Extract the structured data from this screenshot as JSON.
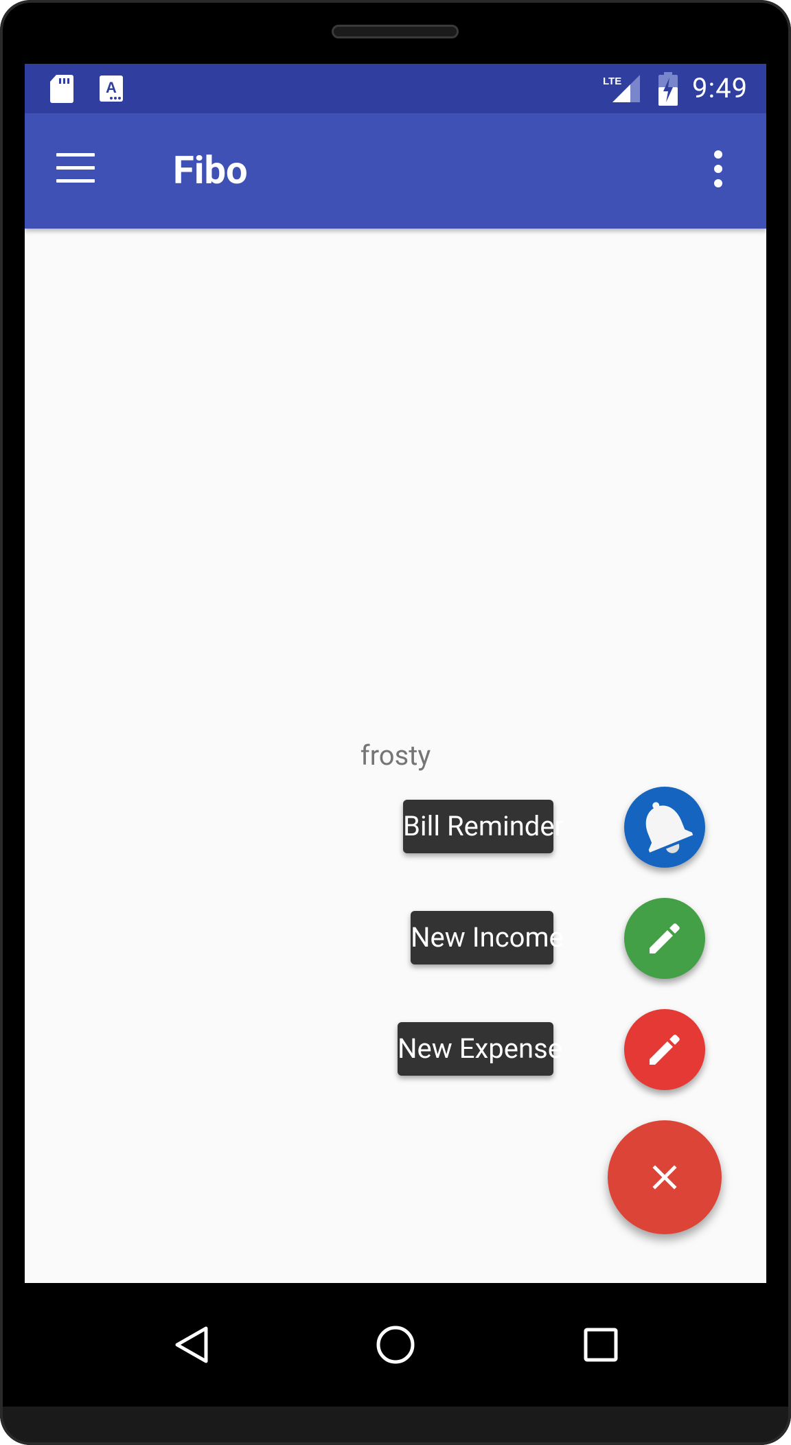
{
  "status_bar": {
    "time": "9:49",
    "network": "LTE",
    "icons": [
      "sd-card-icon",
      "accessibility-a-icon",
      "lte-signal-icon",
      "battery-charging-icon"
    ]
  },
  "app_bar": {
    "title": "Fibo",
    "menu_icon": "hamburger-menu-icon",
    "overflow_icon": "more-vert-icon"
  },
  "content": {
    "center_text": "frosty"
  },
  "fab_menu": {
    "items": [
      {
        "label": "Bill Reminder",
        "icon": "bell-icon",
        "color": "#1565c0"
      },
      {
        "label": "New Income",
        "icon": "pencil-icon",
        "color": "#43a047"
      },
      {
        "label": "New Expense",
        "icon": "pencil-icon",
        "color": "#e53935"
      }
    ],
    "main_fab": {
      "icon": "close-icon",
      "color": "#db4437"
    }
  },
  "nav_bar": {
    "buttons": [
      "back-icon",
      "home-icon",
      "recents-icon"
    ]
  },
  "colors": {
    "status_bar": "#303f9f",
    "app_bar": "#3f51b5",
    "background": "#fafafa",
    "label_bg": "#333333"
  }
}
